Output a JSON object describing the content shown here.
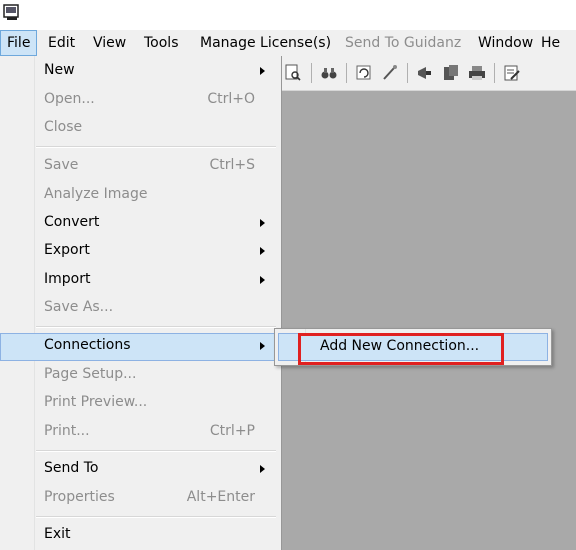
{
  "menubar": {
    "items": [
      {
        "label": "File",
        "state": "active"
      },
      {
        "label": "Edit",
        "state": "normal"
      },
      {
        "label": "View",
        "state": "normal"
      },
      {
        "label": "Tools",
        "state": "normal"
      },
      {
        "label": "Manage License(s)",
        "state": "normal"
      },
      {
        "label": "Send To Guidanz",
        "state": "disabled"
      },
      {
        "label": "Window",
        "state": "normal"
      },
      {
        "label": "He",
        "state": "normal"
      }
    ]
  },
  "file_menu": {
    "items": [
      {
        "label": "New",
        "shortcut": "",
        "submenu": true,
        "disabled": false
      },
      {
        "label": "Open...",
        "shortcut": "Ctrl+O",
        "submenu": false,
        "disabled": true
      },
      {
        "label": "Close",
        "shortcut": "",
        "submenu": false,
        "disabled": true
      },
      {
        "label": "Save",
        "shortcut": "Ctrl+S",
        "submenu": false,
        "disabled": true
      },
      {
        "label": "Analyze Image",
        "shortcut": "",
        "submenu": false,
        "disabled": true
      },
      {
        "label": "Convert",
        "shortcut": "",
        "submenu": true,
        "disabled": false
      },
      {
        "label": "Export",
        "shortcut": "",
        "submenu": true,
        "disabled": false
      },
      {
        "label": "Import",
        "shortcut": "",
        "submenu": true,
        "disabled": false
      },
      {
        "label": "Save As...",
        "shortcut": "",
        "submenu": false,
        "disabled": true
      },
      {
        "label": "Connections",
        "shortcut": "",
        "submenu": true,
        "disabled": false,
        "highlighted": true
      },
      {
        "label": "Page Setup...",
        "shortcut": "",
        "submenu": false,
        "disabled": true
      },
      {
        "label": "Print Preview...",
        "shortcut": "",
        "submenu": false,
        "disabled": true
      },
      {
        "label": "Print...",
        "shortcut": "Ctrl+P",
        "submenu": false,
        "disabled": true
      },
      {
        "label": "Send To",
        "shortcut": "",
        "submenu": true,
        "disabled": false
      },
      {
        "label": "Properties",
        "shortcut": "Alt+Enter",
        "submenu": false,
        "disabled": true
      },
      {
        "label": "Exit",
        "shortcut": "",
        "submenu": false,
        "disabled": false
      }
    ]
  },
  "connections_submenu": {
    "items": [
      {
        "label": "Add New Connection..."
      }
    ]
  },
  "toolbar": {
    "icons": [
      "print-preview-icon",
      "find-icon",
      "refresh-icon",
      "brush-icon",
      "megaphone-icon",
      "report-icon",
      "printer-icon",
      "document-edit-icon"
    ]
  },
  "colors": {
    "menu_bg": "#f0f0f0",
    "highlight": "#cde4f7",
    "highlight_border": "#8db2e3",
    "workspace": "#a9a9a9",
    "callout": "#e02020",
    "disabled_text": "#8d8d8d"
  }
}
